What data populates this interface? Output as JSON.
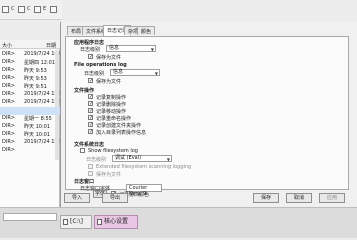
{
  "toolbar": {
    "item1": "C",
    "item2": "C",
    "item3": "E"
  },
  "filelist": {
    "col_size": "大小",
    "col_date": "日期",
    "rows": [
      {
        "size": "DIR>",
        "date": "2019/7/24 16:01"
      },
      {
        "size": "DIR>",
        "date": "星期四 12:01"
      },
      {
        "size": "DIR>",
        "date": "昨天 9:53"
      },
      {
        "size": "DIR>",
        "date": "昨天 9:53"
      },
      {
        "size": "DIR>",
        "date": "昨天 9:51"
      },
      {
        "size": "DIR>",
        "date": "2019/7/24 15:59"
      },
      {
        "size": "DIR>",
        "date": "2019/7/24 15:58"
      },
      {
        "size": "DIR>",
        "date": "2019/7/24 15:55"
      },
      {
        "size": "DIR>",
        "date": "星期一 8:55"
      },
      {
        "size": "DIR>",
        "date": "昨天 10:01"
      },
      {
        "size": "DIR>",
        "date": "昨天 10:01"
      },
      {
        "size": "DIR>",
        "date": "2019/7/24 15:59"
      },
      {
        "size": "DIR>",
        "date": ""
      }
    ]
  },
  "dialog": {
    "tabs": [
      "布局",
      "文件系统",
      "日志记录",
      "杂项",
      "颜色"
    ],
    "active_tab_index": 2,
    "sections": {
      "app_log": "应用程序日志",
      "file_ops_log": "File operations log",
      "file_ops": "文件操作",
      "fs_log": "文件系统日志",
      "log_window": "日志窗口"
    },
    "app_log": {
      "level_label": "日志级别",
      "level_value": "信息",
      "save_to_file": "保存为文件",
      "save_checked": true
    },
    "file_ops_log": {
      "level_label": "日志级别",
      "level_value": "信息",
      "save_to_file": "保存为文件",
      "save_checked": true
    },
    "file_ops": [
      {
        "label": "记录复制操作",
        "checked": true
      },
      {
        "label": "记录删除操作",
        "checked": true
      },
      {
        "label": "记录移动操作",
        "checked": true
      },
      {
        "label": "记录重命名操作",
        "checked": true
      },
      {
        "label": "记录创建文件夹操作",
        "checked": true
      },
      {
        "label": "加入目录列表操作信息",
        "checked": true
      }
    ],
    "fs_log": {
      "show_label": "Show filesystem log",
      "show_checked": false,
      "level_label": "日志级别",
      "level_value": "调试 (Eval)",
      "extended_label": "Extended filesystem scanning logging",
      "extended_checked": false,
      "save_to_file": "保存为文件",
      "save_checked": false
    },
    "log_window": {
      "font_label": "日志窗口字体",
      "font_value": "Courier New, 9",
      "font_button": "字体",
      "color_label": "记录窗口颜色",
      "color_checked": true
    },
    "buttons": {
      "import": "导入",
      "export": "导出",
      "save": "保存",
      "cancel": "取消",
      "apply": "应用"
    }
  },
  "taskbar": {
    "tab1": "[C:\\]",
    "tab2": "核心设置"
  }
}
